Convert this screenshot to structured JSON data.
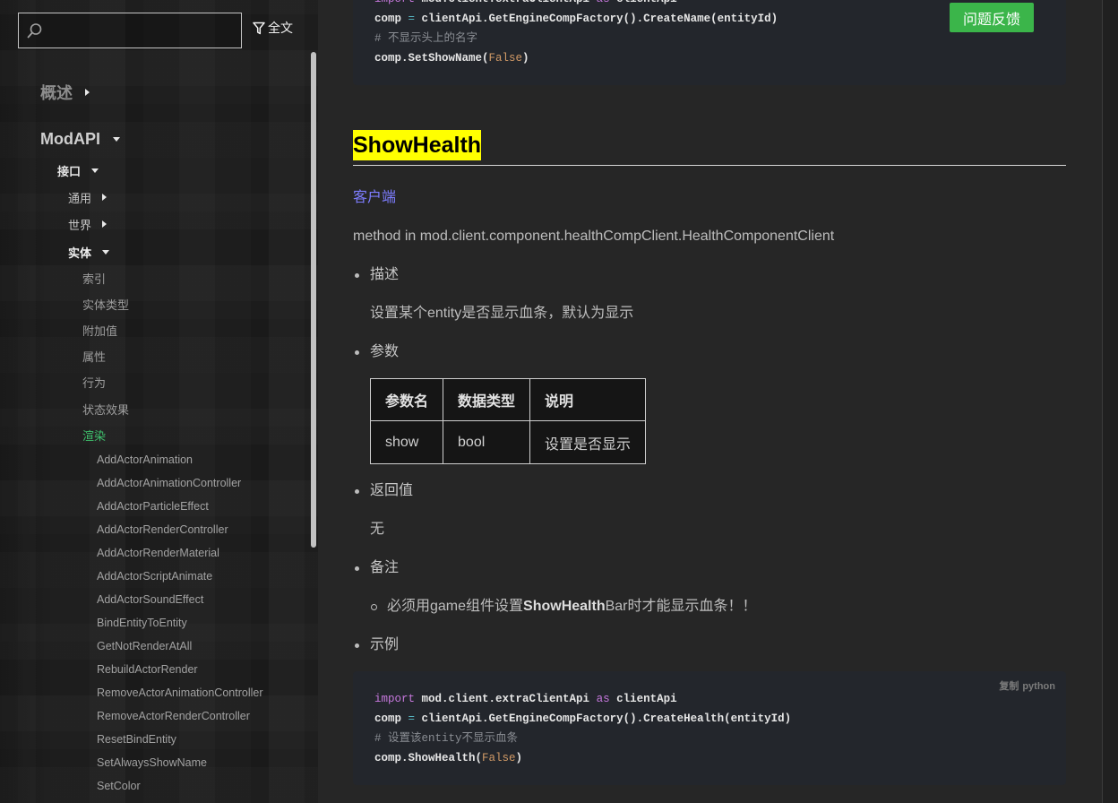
{
  "sidebar": {
    "search": {
      "placeholder": ""
    },
    "filter_label": "全文",
    "nav": {
      "overview": "概述",
      "modapi": "ModAPI",
      "interface": "接口",
      "general": "通用",
      "world": "世界",
      "entity": "实体",
      "entity_items": [
        "索引",
        "实体类型",
        "附加值",
        "属性",
        "行为",
        "状态效果",
        "渲染"
      ],
      "entity_items_active": 6,
      "render_items": [
        "AddActorAnimation",
        "AddActorAnimationController",
        "AddActorParticleEffect",
        "AddActorRenderController",
        "AddActorRenderMaterial",
        "AddActorScriptAnimate",
        "AddActorSoundEffect",
        "BindEntityToEntity",
        "GetNotRenderAtAll",
        "RebuildActorRender",
        "RemoveActorAnimationController",
        "RemoveActorRenderController",
        "ResetBindEntity",
        "SetAlwaysShowName",
        "SetColor"
      ]
    }
  },
  "feedback_button": "问题反馈",
  "top_code": {
    "lines": [
      [
        {
          "t": "import",
          "keyword": true
        },
        {
          "t": " mod.client.extraClientApi "
        },
        {
          "t": "as",
          "keyword": true
        },
        {
          "t": " clientApi"
        }
      ],
      [
        {
          "t": "comp "
        },
        {
          "t": "=",
          "operator": true
        },
        {
          "t": " clientApi.GetEngineCompFactory().CreateName(entityId)"
        }
      ],
      [
        {
          "t": "# 不显示头上的名字",
          "comment": true
        }
      ],
      [
        {
          "t": "comp.SetShowName("
        },
        {
          "t": "False",
          "literal": true
        },
        {
          "t": ")"
        }
      ]
    ]
  },
  "doc": {
    "title": "ShowHealth",
    "side": "客户端",
    "method": "method in mod.client.component.healthCompClient.HealthComponentClient",
    "desc_label": "描述",
    "desc_text": "设置某个entity是否显示血条，默认为显示",
    "params_label": "参数",
    "params": {
      "headers": [
        "参数名",
        "数据类型",
        "说明"
      ],
      "rows": [
        [
          "show",
          "bool",
          "设置是否显示"
        ]
      ]
    },
    "return_label": "返回值",
    "return_text": "无",
    "notes_label": "备注",
    "note": {
      "before": "必须用game组件设置",
      "bold": "ShowHealth",
      "after": "Bar时才能显示血条！！"
    },
    "example_label": "示例",
    "example": {
      "copy_label": "复制",
      "lang": "python",
      "lines": [
        [
          {
            "t": "import",
            "keyword": true
          },
          {
            "t": " mod.client.extraClientApi "
          },
          {
            "t": "as",
            "keyword": true
          },
          {
            "t": " clientApi"
          }
        ],
        [
          {
            "t": "comp "
          },
          {
            "t": "=",
            "operator": true
          },
          {
            "t": " clientApi.GetEngineCompFactory().CreateHealth(entityId)"
          }
        ],
        [
          {
            "t": "# 设置该entity不显示血条",
            "comment": true
          }
        ],
        [
          {
            "t": "comp.ShowHealth("
          },
          {
            "t": "False",
            "literal": true
          },
          {
            "t": ")"
          }
        ]
      ]
    }
  },
  "icons": {
    "search": "search-icon",
    "filter": "filter-icon",
    "collapsed": "caret-right-icon",
    "expanded": "caret-down-icon"
  },
  "colors": {
    "accent_active": "#3ec06c",
    "link": "#7d7dff",
    "title_highlight": "#ffff00",
    "feedback_button_bg": "#3bb54a",
    "code_bg": "#23262c",
    "syntax_keyword": "#c678dd",
    "syntax_literal": "#d19a66",
    "syntax_comment": "#8a8d93",
    "syntax_operator": "#56b6c2"
  }
}
